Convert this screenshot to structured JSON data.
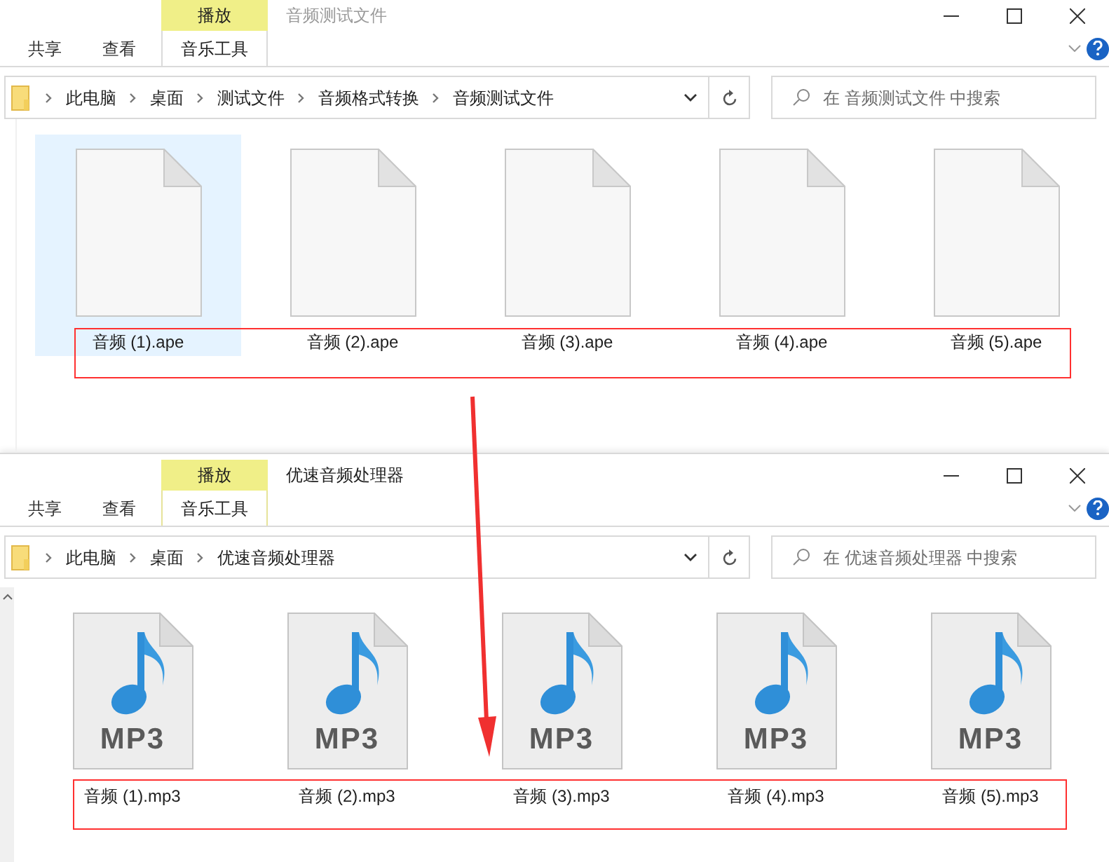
{
  "windows": [
    {
      "title": "音频测试文件",
      "active": false,
      "context_tab": "播放",
      "tabs": [
        {
          "label": "共享",
          "selected": false
        },
        {
          "label": "查看",
          "selected": false
        },
        {
          "label": "音乐工具",
          "selected": true
        }
      ],
      "breadcrumb": [
        "此电脑",
        "桌面",
        "测试文件",
        "音频格式转换",
        "音频测试文件"
      ],
      "search": {
        "placeholder": "在 音频测试文件 中搜索"
      },
      "files": [
        {
          "name": "音频 (1).ape",
          "kind": "blank",
          "selected": true
        },
        {
          "name": "音频 (2).ape",
          "kind": "blank",
          "selected": false
        },
        {
          "name": "音频 (3).ape",
          "kind": "blank",
          "selected": false
        },
        {
          "name": "音频 (4).ape",
          "kind": "blank",
          "selected": false
        },
        {
          "name": "音频 (5).ape",
          "kind": "blank",
          "selected": false
        }
      ]
    },
    {
      "title": "优速音频处理器",
      "active": true,
      "context_tab": "播放",
      "tabs": [
        {
          "label": "共享",
          "selected": false
        },
        {
          "label": "查看",
          "selected": false
        },
        {
          "label": "音乐工具",
          "selected": true
        }
      ],
      "breadcrumb": [
        "此电脑",
        "桌面",
        "优速音频处理器"
      ],
      "search": {
        "placeholder": "在 优速音频处理器 中搜索"
      },
      "files": [
        {
          "name": "音频 (1).mp3",
          "kind": "mp3",
          "icon_label": "MP3",
          "selected": false
        },
        {
          "name": "音频 (2).mp3",
          "kind": "mp3",
          "icon_label": "MP3",
          "selected": false
        },
        {
          "name": "音频 (3).mp3",
          "kind": "mp3",
          "icon_label": "MP3",
          "selected": false
        },
        {
          "name": "音频 (4).mp3",
          "kind": "mp3",
          "icon_label": "MP3",
          "selected": false
        },
        {
          "name": "音频 (5).mp3",
          "kind": "mp3",
          "icon_label": "MP3",
          "selected": false
        }
      ]
    }
  ]
}
